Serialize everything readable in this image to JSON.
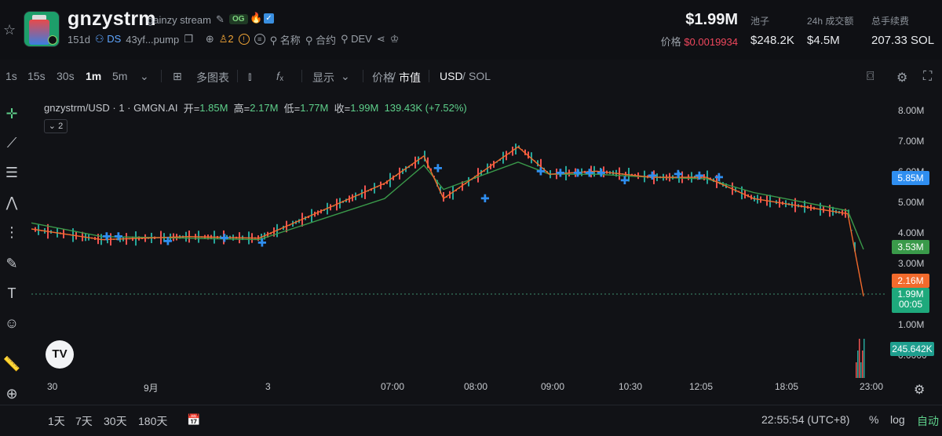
{
  "token": {
    "ticker": "gnzystrm",
    "name": "gainzy stream",
    "og_label": "OG",
    "age": "151d",
    "dex": "DS",
    "address": "43yf...pump",
    "holders_count": "2",
    "meta_links": [
      "名称",
      "合约",
      "DEV"
    ]
  },
  "header": {
    "market_cap": "$1.99M",
    "price_label": "价格",
    "price_value": "$0.0019934",
    "stats": [
      {
        "label": "池子",
        "value": "$248.2K"
      },
      {
        "label": "24h 成交额",
        "value": "$4.5M"
      },
      {
        "label": "总手续费",
        "value": "207.33 SOL"
      }
    ]
  },
  "toolbar": {
    "timeframes": [
      "1s",
      "15s",
      "30s",
      "1m",
      "5m"
    ],
    "active_timeframe": "1m",
    "multi_chart": "多图表",
    "display": "显示",
    "price_label": "价格",
    "mcap_label": "市值",
    "usd_label": "USD",
    "sol_label": "SOL"
  },
  "chart": {
    "legend_title": "gnzystrm/USD · 1 · GMGN.AI",
    "open_label": "开=",
    "open": "1.85M",
    "high_label": "高=",
    "high": "2.17M",
    "low_label": "低=",
    "low": "1.77M",
    "close_label": "收=",
    "close": "1.99M",
    "change": "139.43K (+7.52%)",
    "indicator_count": "2",
    "y_ticks": [
      "8.00M",
      "7.00M",
      "6.00M",
      "5.00M",
      "4.00M",
      "3.00M",
      "2.00M",
      "1.00M",
      "0.0000"
    ],
    "tags": {
      "blue": "5.85M",
      "green": "3.53M",
      "orange": "2.16M",
      "current": "1.99M",
      "countdown": "00:05",
      "volume": "245.642K"
    },
    "x_ticks": [
      "30",
      "9月",
      "3",
      "07:00",
      "08:00",
      "09:00",
      "10:30",
      "12:05",
      "18:05",
      "23:00"
    ],
    "colors": {
      "line": "#f26a2c",
      "ma": "#3a9a4a",
      "up": "#26a69a",
      "down": "#ef5350",
      "marker": "#2f8ef0"
    }
  },
  "chart_data": {
    "type": "line",
    "title": "gnzystrm/USD · 1 · GMGN.AI",
    "x": [
      "30",
      "9月",
      "3",
      "07:00",
      "08:00",
      "09:00",
      "10:30",
      "12:05",
      "18:05",
      "23:00"
    ],
    "series": [
      {
        "values": [
          4.2,
          3.85,
          3.95,
          3.9,
          5.7,
          6.6,
          5.2,
          6.9,
          6.0,
          6.1,
          5.9,
          5.9,
          5.2,
          4.7,
          1.99
        ]
      },
      {
        "values": [
          4.4,
          3.95,
          3.9,
          3.85,
          5.2,
          6.3,
          5.5,
          6.4,
          6.0,
          6.0,
          5.9,
          5.85,
          5.4,
          4.8,
          3.53
        ]
      }
    ],
    "ylim": [
      0,
      8.5
    ]
  },
  "bottom": {
    "ranges": [
      "1天",
      "7天",
      "30天",
      "180天"
    ],
    "time": "22:55:54 (UTC+8)",
    "percent": "%",
    "log": "log",
    "auto": "自动"
  }
}
